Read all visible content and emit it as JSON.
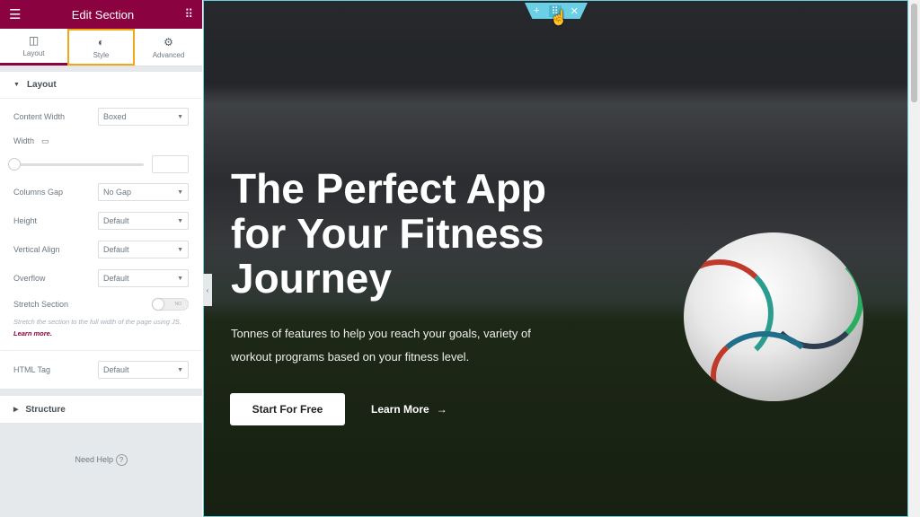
{
  "panel": {
    "title": "Edit Section",
    "tabs": [
      {
        "label": "Layout",
        "icon": "columns-icon"
      },
      {
        "label": "Style",
        "icon": "half-circle-icon"
      },
      {
        "label": "Advanced",
        "icon": "gear-icon"
      }
    ],
    "layout_section": "Layout",
    "fields": {
      "content_width": {
        "label": "Content Width",
        "value": "Boxed"
      },
      "width": {
        "label": "Width"
      },
      "columns_gap": {
        "label": "Columns Gap",
        "value": "No Gap"
      },
      "height": {
        "label": "Height",
        "value": "Default"
      },
      "vertical_align": {
        "label": "Vertical Align",
        "value": "Default"
      },
      "overflow": {
        "label": "Overflow",
        "value": "Default"
      },
      "stretch": {
        "label": "Stretch Section",
        "toggle": "NO",
        "note": "Stretch the section to the full width of the page using JS.",
        "link": "Learn more."
      },
      "html_tag": {
        "label": "HTML Tag",
        "value": "Default"
      }
    },
    "structure_section": "Structure",
    "help": "Need Help"
  },
  "hero": {
    "title": "The Perfect App for Your Fitness Journey",
    "subtitle": "Tonnes of features to help you reach your goals, variety of workout programs based on your fitness level.",
    "primary": "Start For Free",
    "secondary": "Learn More"
  },
  "colors": {
    "brand": "#8a0340",
    "highlight": "#f0a818",
    "section_handle": "#6ad0e6"
  }
}
